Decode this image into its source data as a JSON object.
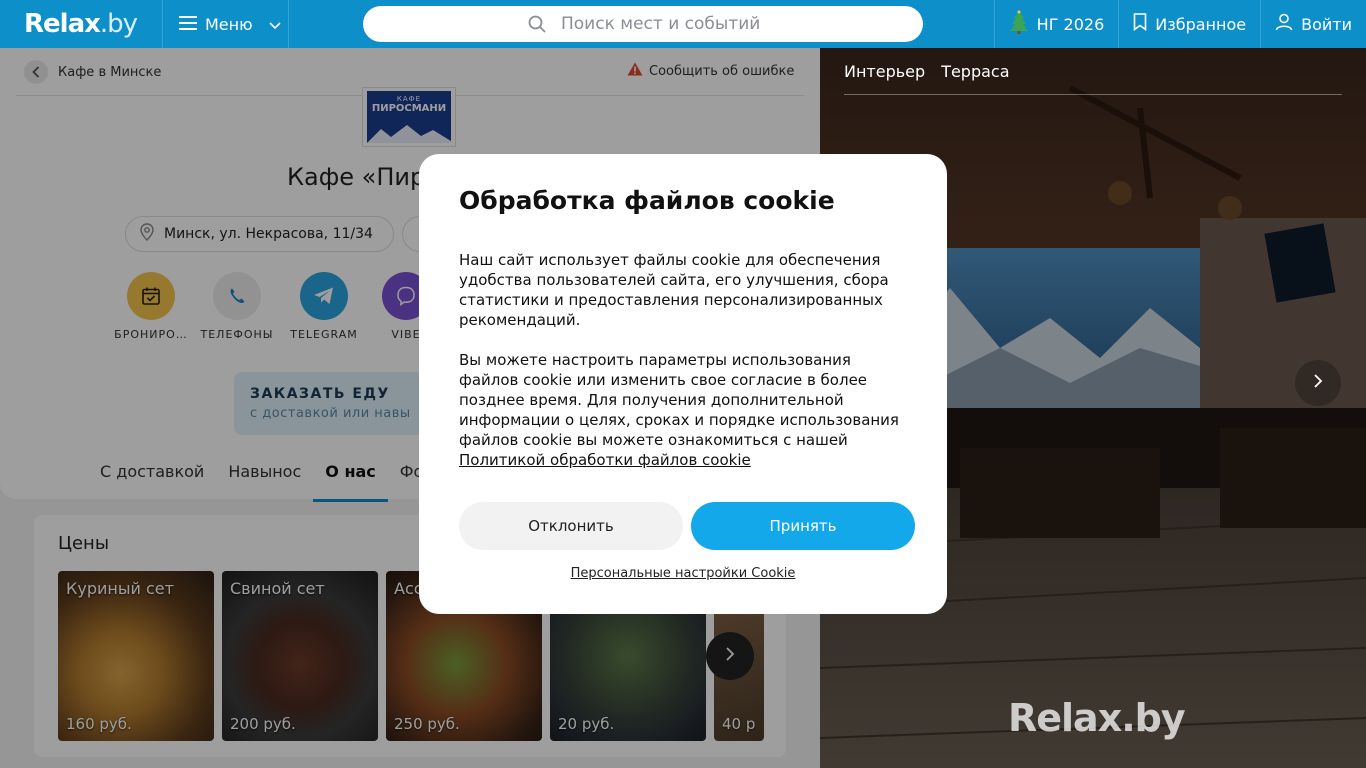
{
  "header": {
    "logo": "Relax",
    "logo_suffix": ".by",
    "menu_label": "Меню",
    "search_placeholder": "Поиск мест и событий",
    "ny_label": "НГ 2026",
    "favorites_label": "Избранное",
    "login_label": "Войти"
  },
  "page": {
    "breadcrumb": "Кафе в Минске",
    "report_error": "Сообщить об ошибке",
    "cafe_logo_top": "КАФЕ",
    "cafe_logo_name": "ПИРОСМАНИ",
    "title": "Кафе «Пир",
    "address": "Минск, ул. Некрасова, 11/34",
    "actions": [
      "БРОНИРО…",
      "ТЕЛЕФОНЫ",
      "TELEGRAM",
      "VIBE"
    ],
    "order_title": "ЗАКАЗАТЬ ЕДУ",
    "order_subtitle": "с доставкой или навы",
    "tabs": [
      "С доставкой",
      "Навынос",
      "О нас",
      "Фото"
    ],
    "active_tab": "О нас"
  },
  "prices": {
    "title": "Цены",
    "items": [
      {
        "name": "Куриный сет",
        "price": "160 руб."
      },
      {
        "name": "Свиной сет",
        "price": "200 руб."
      },
      {
        "name": "Ассо",
        "price": "250 руб."
      },
      {
        "name": "",
        "price": "20 руб."
      },
      {
        "name": "",
        "price": "40 р"
      }
    ]
  },
  "gallery": {
    "tabs": [
      "Интерьер",
      "Терраса"
    ],
    "watermark": "Relax.by"
  },
  "cookie_modal": {
    "title": "Обработка файлов cookie",
    "paragraph1": "Наш сайт использует файлы cookie для обеспечения удобства пользователей сайта, его улучшения, сбора статистики и предоставления персонализированных рекомендаций.",
    "paragraph2": "Вы можете настроить параметры использования файлов cookie или изменить свое согласие в более позднее время. Для получения дополнительной информации о целях, сроках и порядке использования файлов cookie вы можете ознакомиться с нашей",
    "policy_link": "Политикой обработки файлов cookie",
    "decline": "Отклонить",
    "accept": "Принять",
    "personal_settings": "Персональные настройки Cookie"
  },
  "colors": {
    "brand": "#0d8fc9",
    "accept_button": "#12a8ea",
    "booking_icon_bg": "#f2c44b",
    "telegram_bg": "#2aa3df",
    "viber_bg": "#7a4fd0"
  }
}
